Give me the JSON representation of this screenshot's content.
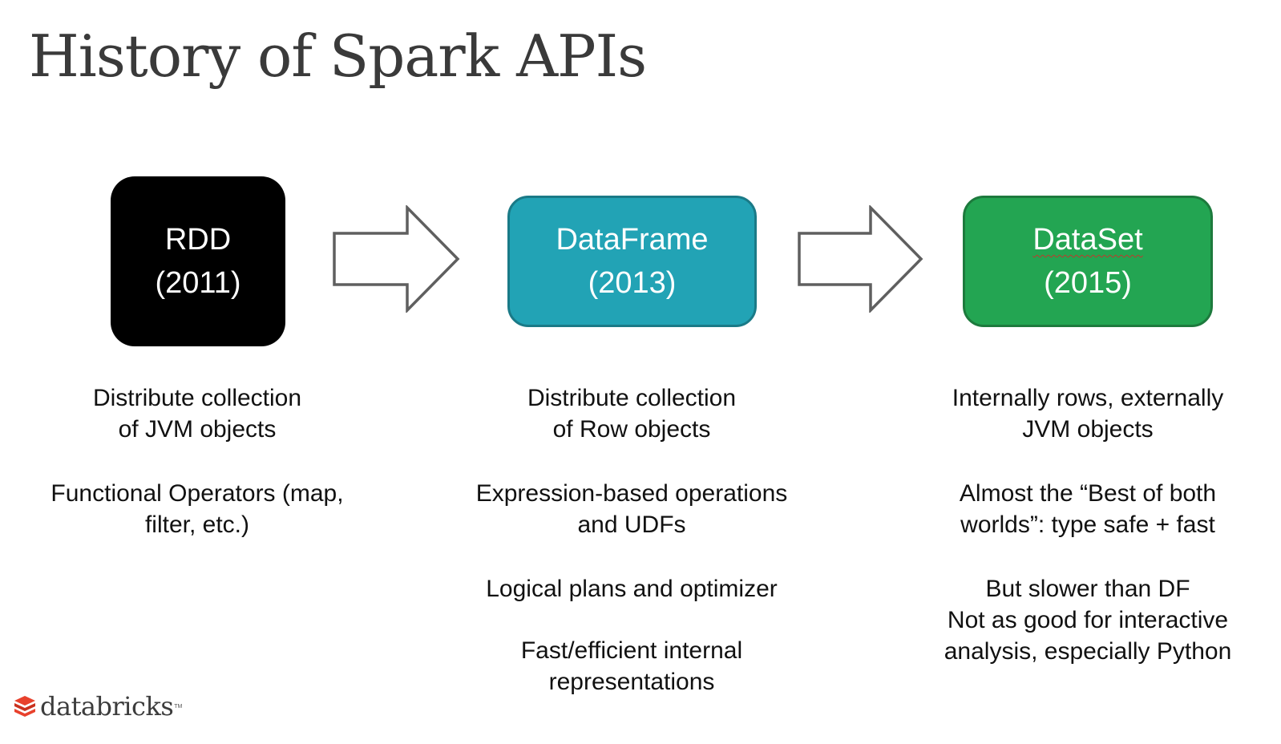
{
  "slide": {
    "title": "History of Spark APIs"
  },
  "boxes": [
    {
      "name": "RDD",
      "year": "(2011)",
      "color": "#000000"
    },
    {
      "name": "DataFrame",
      "year": "(2013)",
      "color": "#22a3b5"
    },
    {
      "name": "DataSet",
      "year": "(2015)",
      "color": "#23a552"
    }
  ],
  "arrows": [
    {
      "from": "RDD",
      "to": "DataFrame"
    },
    {
      "from": "DataFrame",
      "to": "DataSet"
    }
  ],
  "descriptions": {
    "rdd": [
      [
        "Distribute collection",
        "of JVM objects"
      ],
      [
        "Functional Operators (map,",
        "filter, etc.)"
      ]
    ],
    "dataframe": [
      [
        "Distribute collection",
        "of Row objects"
      ],
      [
        "Expression-based operations",
        "and UDFs"
      ],
      [
        "Logical plans and optimizer"
      ],
      [
        "Fast/efficient internal",
        "representations"
      ]
    ],
    "dataset": [
      [
        "Internally rows, externally",
        "JVM objects"
      ],
      [
        "Almost the “Best of both",
        "worlds”: type safe + fast"
      ],
      [
        "But slower than DF",
        "Not as good for interactive",
        "analysis, especially Python"
      ]
    ]
  },
  "footer": {
    "logo_text": "databricks",
    "logo_tm": "TM",
    "logo_color": "#e8412c"
  }
}
